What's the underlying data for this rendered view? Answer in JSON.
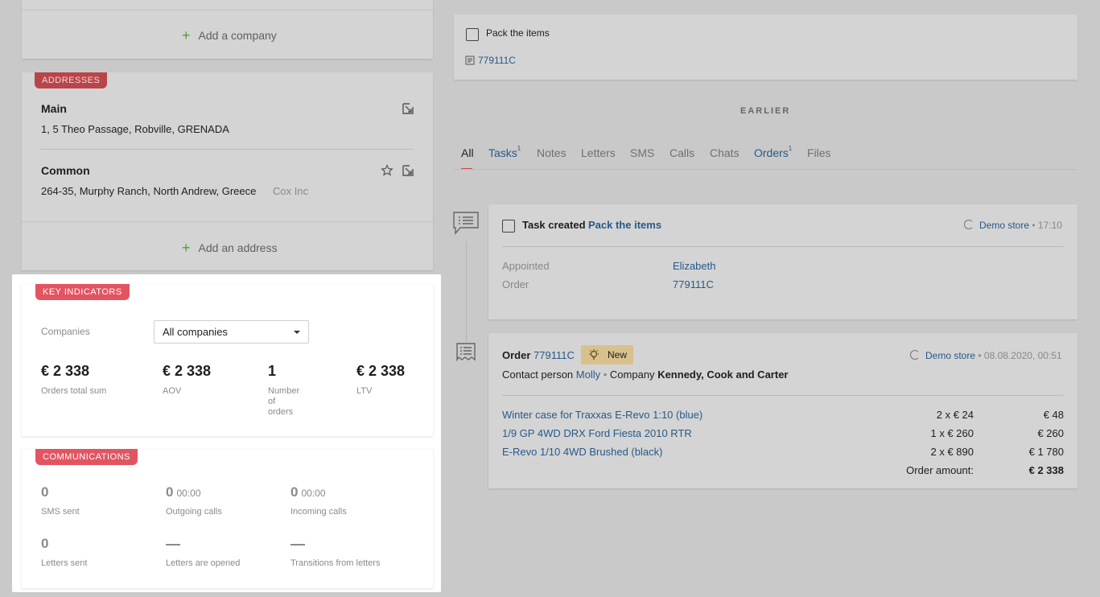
{
  "left": {
    "companies_add": "Add a company",
    "addresses": {
      "badge": "ADDRESSES",
      "items": [
        {
          "title": "Main",
          "address": "1, 5 Theo Passage, Robville, GRENADA",
          "company": ""
        },
        {
          "title": "Common",
          "address": "264-35, Murphy Ranch, North Andrew, Greece",
          "company": "Cox Inc"
        }
      ],
      "add": "Add an address"
    },
    "key_indicators": {
      "badge": "KEY INDICATORS",
      "companies_label": "Companies",
      "companies_select": "All companies",
      "metrics": [
        {
          "value": "€ 2 338",
          "label": "Orders total sum"
        },
        {
          "value": "€ 2 338",
          "label": "AOV"
        },
        {
          "value": "1",
          "label_lines": [
            "Number",
            "of",
            "orders"
          ]
        },
        {
          "value": "€ 2 338",
          "label": "LTV"
        }
      ]
    },
    "communications": {
      "badge": "COMMUNICATIONS",
      "sms": {
        "value": "0",
        "label": "SMS sent"
      },
      "outgoing": {
        "value": "0",
        "time": "00:00",
        "label": "Outgoing calls"
      },
      "incoming": {
        "value": "0",
        "time": "00:00",
        "label": "Incoming calls"
      },
      "letters": {
        "value": "0",
        "label": "Letters sent"
      },
      "opened": {
        "label": "Letters are opened"
      },
      "transitions": {
        "label": "Transitions from letters"
      }
    }
  },
  "right": {
    "task_top": {
      "title": "Pack the items",
      "order": "779111C"
    },
    "earlier": "EARLIER",
    "tabs": [
      {
        "label": "All",
        "sup": ""
      },
      {
        "label": "Tasks",
        "sup": "1"
      },
      {
        "label": "Notes",
        "sup": ""
      },
      {
        "label": "Letters",
        "sup": ""
      },
      {
        "label": "SMS",
        "sup": ""
      },
      {
        "label": "Calls",
        "sup": ""
      },
      {
        "label": "Chats",
        "sup": ""
      },
      {
        "label": "Orders",
        "sup": "1"
      },
      {
        "label": "Files",
        "sup": ""
      }
    ],
    "task_event": {
      "prefix": "Task created",
      "link": "Pack the items",
      "store": "Demo store",
      "time": "17:10",
      "appointed_label": "Appointed",
      "appointed_value": "Elizabeth",
      "order_label": "Order",
      "order_value": "779111C"
    },
    "order_event": {
      "prefix": "Order",
      "number": "779111C",
      "status": "New",
      "store": "Demo store",
      "datetime": "08.08.2020, 00:51",
      "contact_label": "Contact person",
      "contact": "Molly",
      "company_label": "Company",
      "company": "Kennedy, Cook and Carter",
      "items": [
        {
          "name": "Winter case for Traxxas E-Revo 1:10 (blue)",
          "qty": "2 x € 24",
          "sum": "€ 48"
        },
        {
          "name": "1/9 GP 4WD DRX Ford Fiesta 2010 RTR",
          "qty": "1 x € 260",
          "sum": "€ 260"
        },
        {
          "name": "E-Revo 1/10 4WD Brushed (black)",
          "qty": "2 x € 890",
          "sum": "€ 1 780"
        }
      ],
      "amount_label": "Order amount:",
      "amount": "€ 2 338"
    }
  },
  "colors": {
    "accent_red": "#e35461",
    "link": "#27598a",
    "plus": "#5a9a3a",
    "status_new": "#d9c18e"
  }
}
